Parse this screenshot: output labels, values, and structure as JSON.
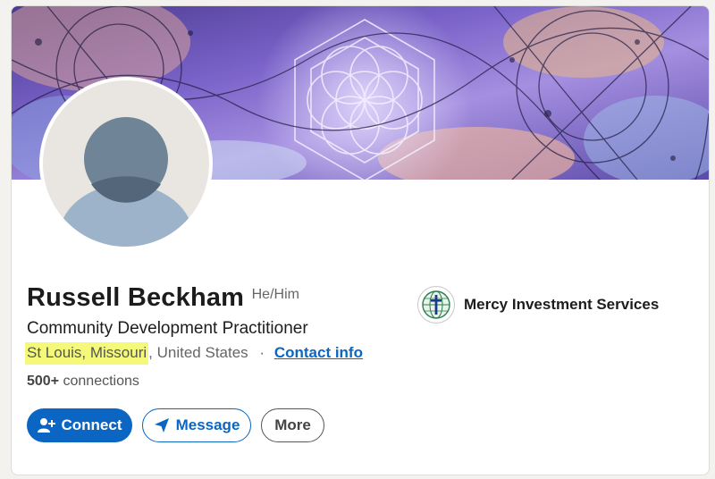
{
  "profile": {
    "name": "Russell Beckham",
    "pronouns": "He/Him",
    "headline": "Community Development Practitioner",
    "location_highlighted": "St Louis, Missouri",
    "location_rest": ", United States",
    "separator": "·",
    "contact_info_label": "Contact info",
    "connections_count": "500+",
    "connections_label": "connections"
  },
  "company": {
    "name": "Mercy Investment Services",
    "logo_icon": "globe-cross-icon"
  },
  "actions": {
    "connect_label": "Connect",
    "message_label": "Message",
    "more_label": "More"
  },
  "colors": {
    "accent": "#0a66c2",
    "highlight": "#f4f97a",
    "banner_primary": "#6a4fb8"
  }
}
